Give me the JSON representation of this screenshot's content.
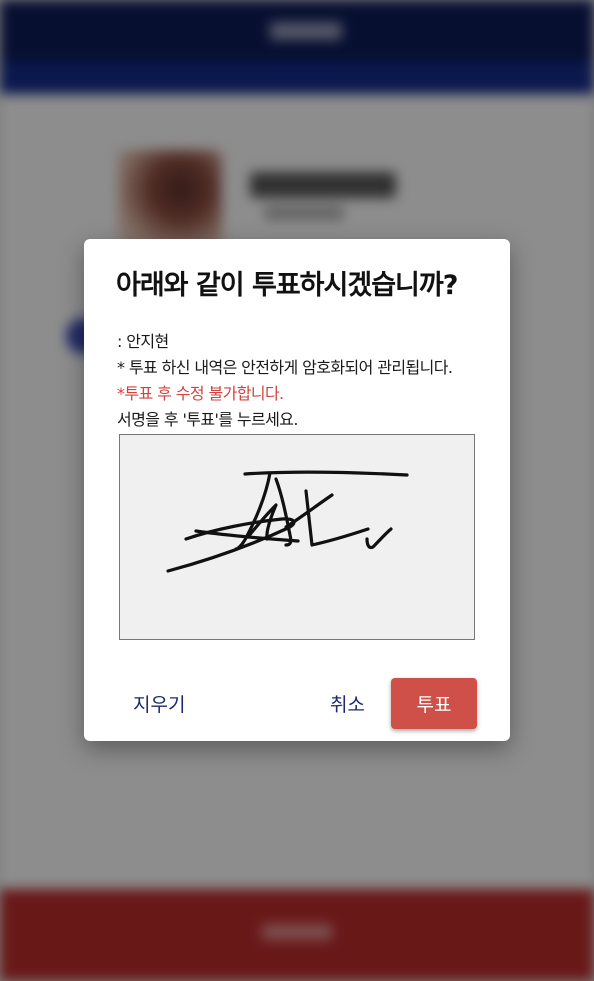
{
  "background": {
    "header_color": "#0d1a55",
    "band_color": "#142a86",
    "footer_color": "#b52a2a"
  },
  "dialog": {
    "title": "아래와 같이 투표하시겠습니까?",
    "candidate_line": ": 안지현",
    "notice_line": "* 투표 하신 내역은 안전하게 암호화되어 관리됩니다.",
    "warning_line": "*투표 후 수정 불가합니다.",
    "instruction_line": "서명을 후 '투표'를 누르세요.",
    "warning_color": "#d0433e",
    "buttons": {
      "clear": "지우기",
      "cancel": "취소",
      "vote": "투표"
    },
    "vote_button_color": "#cf5048"
  }
}
